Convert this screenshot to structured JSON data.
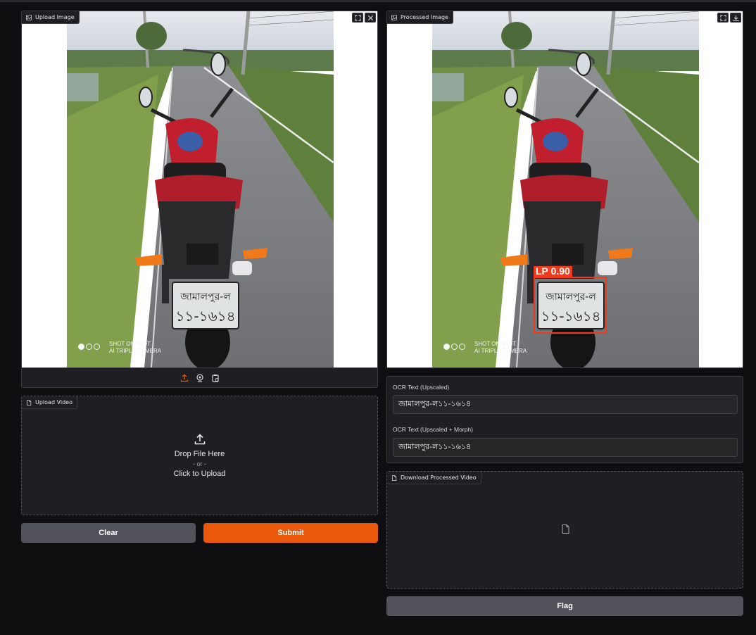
{
  "upload_image": {
    "label": "Upload Image",
    "watermark_line1": "SHOT ON MI 9T",
    "watermark_line2": "AI TRIPLE CAMERA",
    "plate_text_top": "জামালপুর-ল",
    "plate_text_bottom": "১১-১৬১৪"
  },
  "processed_image": {
    "label": "Processed Image",
    "detection_label": "LP 0.90",
    "watermark_line1": "SHOT ON MI 9T",
    "watermark_line2": "AI TRIPLE CAMERA",
    "plate_text_top": "জামালপুর-ল",
    "plate_text_bottom": "১১-১৬১৪"
  },
  "upload_video": {
    "label": "Upload Video",
    "drop_text": "Drop File Here",
    "or_text": "- or -",
    "click_text": "Click to Upload"
  },
  "actions": {
    "clear_label": "Clear",
    "submit_label": "Submit",
    "flag_label": "Flag"
  },
  "ocr": {
    "upscaled_label": "OCR Text (Upscaled)",
    "upscaled_value": "জামালপুর-ল১১-১৬১৪",
    "morph_label": "OCR Text (Upscaled + Morph)",
    "morph_value": "জামালপুর-ল১১-১৬১৪"
  },
  "download_video": {
    "label": "Download Processed Video"
  },
  "colors": {
    "accent": "#ea580c",
    "detection": "#ef3a1e",
    "background": "#0f0f11",
    "panel": "#1f1f23"
  }
}
